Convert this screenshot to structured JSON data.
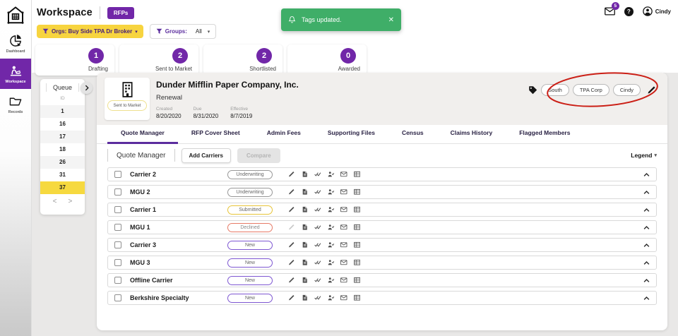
{
  "header": {
    "app_title": "Workspace",
    "badge": "RFPs",
    "notifications_count": "5",
    "user_name": "Cindy",
    "filters": {
      "orgs_label": "Orgs: Buy Side TPA Dr Broker",
      "groups_label": "Groups:",
      "groups_value": "All"
    }
  },
  "toast": {
    "message": "Tags updated."
  },
  "sidebar": {
    "items": [
      {
        "label": "Dashboard"
      },
      {
        "label": "Workspace"
      },
      {
        "label": "Records"
      }
    ]
  },
  "stat_cards": [
    {
      "count": "1",
      "label": "Drafting"
    },
    {
      "count": "2",
      "label": "Sent to Market"
    },
    {
      "count": "2",
      "label": "Shortlisted"
    },
    {
      "count": "0",
      "label": "Awarded"
    }
  ],
  "queue": {
    "title": "Queue",
    "column": "ID",
    "rows": [
      {
        "value": "1",
        "state": ""
      },
      {
        "value": "16",
        "state": ""
      },
      {
        "value": "17",
        "state": ""
      },
      {
        "value": "18",
        "state": ""
      },
      {
        "value": "26",
        "state": ""
      },
      {
        "value": "31",
        "state": ""
      },
      {
        "value": "37",
        "state": "selected"
      }
    ]
  },
  "company": {
    "name": "Dunder Mifflin Paper Company, Inc.",
    "type": "Renewal",
    "status": "Sent to Market",
    "dates": [
      {
        "label": "Created",
        "value": "8/20/2020"
      },
      {
        "label": "Due",
        "value": "8/31/2020"
      },
      {
        "label": "Effective",
        "value": "8/7/2019"
      }
    ],
    "tags": [
      "South",
      "TPA Corp",
      "Cindy"
    ]
  },
  "tabs": [
    "Quote Manager",
    "RFP Cover Sheet",
    "Admin Fees",
    "Supporting Files",
    "Census",
    "Claims History",
    "Flagged Members"
  ],
  "quote_manager": {
    "section_title": "Quote Manager",
    "add_carriers_label": "Add Carriers",
    "compare_label": "Compare",
    "legend_label": "Legend",
    "rows": [
      {
        "name": "Carrier 2",
        "status": "Underwriting",
        "status_type": "underwriting",
        "edit_state": ""
      },
      {
        "name": "MGU 2",
        "status": "Underwriting",
        "status_type": "underwriting",
        "edit_state": ""
      },
      {
        "name": "Carrier 1",
        "status": "Submitted",
        "status_type": "submitted",
        "edit_state": ""
      },
      {
        "name": "MGU 1",
        "status": "Declined",
        "status_type": "declined",
        "edit_state": "disabled"
      },
      {
        "name": "Carrier 3",
        "status": "New",
        "status_type": "new",
        "edit_state": ""
      },
      {
        "name": "MGU 3",
        "status": "New",
        "status_type": "new",
        "edit_state": ""
      },
      {
        "name": "Offline Carrier",
        "status": "New",
        "status_type": "new",
        "edit_state": ""
      },
      {
        "name": "Berkshire Specialty",
        "status": "New",
        "status_type": "new",
        "edit_state": ""
      }
    ]
  },
  "icons": {
    "caret_down": "▾",
    "close": "✕",
    "help": "?",
    "prev": "<",
    "next": ">"
  },
  "colors": {
    "accent_purple": "#7127a8",
    "filter_yellow": "#f7d43f",
    "toast_green": "#3fae68",
    "queue_selected_yellow": "#f6d93f",
    "declined_red": "#e77a66",
    "submitted_yellow": "#e7c437",
    "new_purple": "#7e57d2",
    "annotation_red": "#cb1f16"
  }
}
